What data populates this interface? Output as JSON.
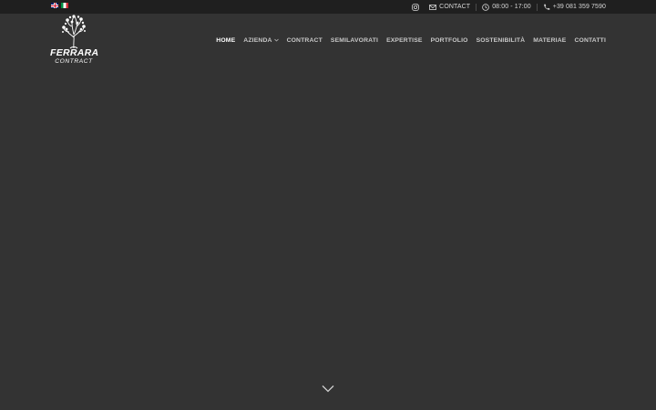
{
  "languages": [
    {
      "code": "en",
      "icon": "uk-flag-icon"
    },
    {
      "code": "it",
      "icon": "italy-flag-icon"
    }
  ],
  "topbar": {
    "instagram_icon": "instagram-icon",
    "contact_label": "CONTACT",
    "contact_icon": "envelope-icon",
    "hours": "08:00 - 17:00",
    "hours_icon": "clock-icon",
    "phone": "+39 081 359 7590",
    "phone_icon": "phone-icon"
  },
  "brand": {
    "name": "FERRARA",
    "tagline": "CONTRACT",
    "logo_icon": "tree-logo-icon"
  },
  "nav": {
    "items": [
      {
        "label": "HOME",
        "active": true
      },
      {
        "label": "AZIENDA",
        "dropdown": true
      },
      {
        "label": "CONTRACT"
      },
      {
        "label": "SEMILAVORATI"
      },
      {
        "label": "EXPERTISE"
      },
      {
        "label": "PORTFOLIO"
      },
      {
        "label": "SOSTENIBILITÀ"
      },
      {
        "label": "MATERIAE"
      },
      {
        "label": "CONTATTI"
      }
    ]
  },
  "hero": {
    "scroll_icon": "chevron-down-icon"
  },
  "colors": {
    "topbar_bg": "#1f1f1f",
    "page_bg": "#333333",
    "nav_text": "#c8c8c8",
    "nav_active": "#ffffff"
  }
}
